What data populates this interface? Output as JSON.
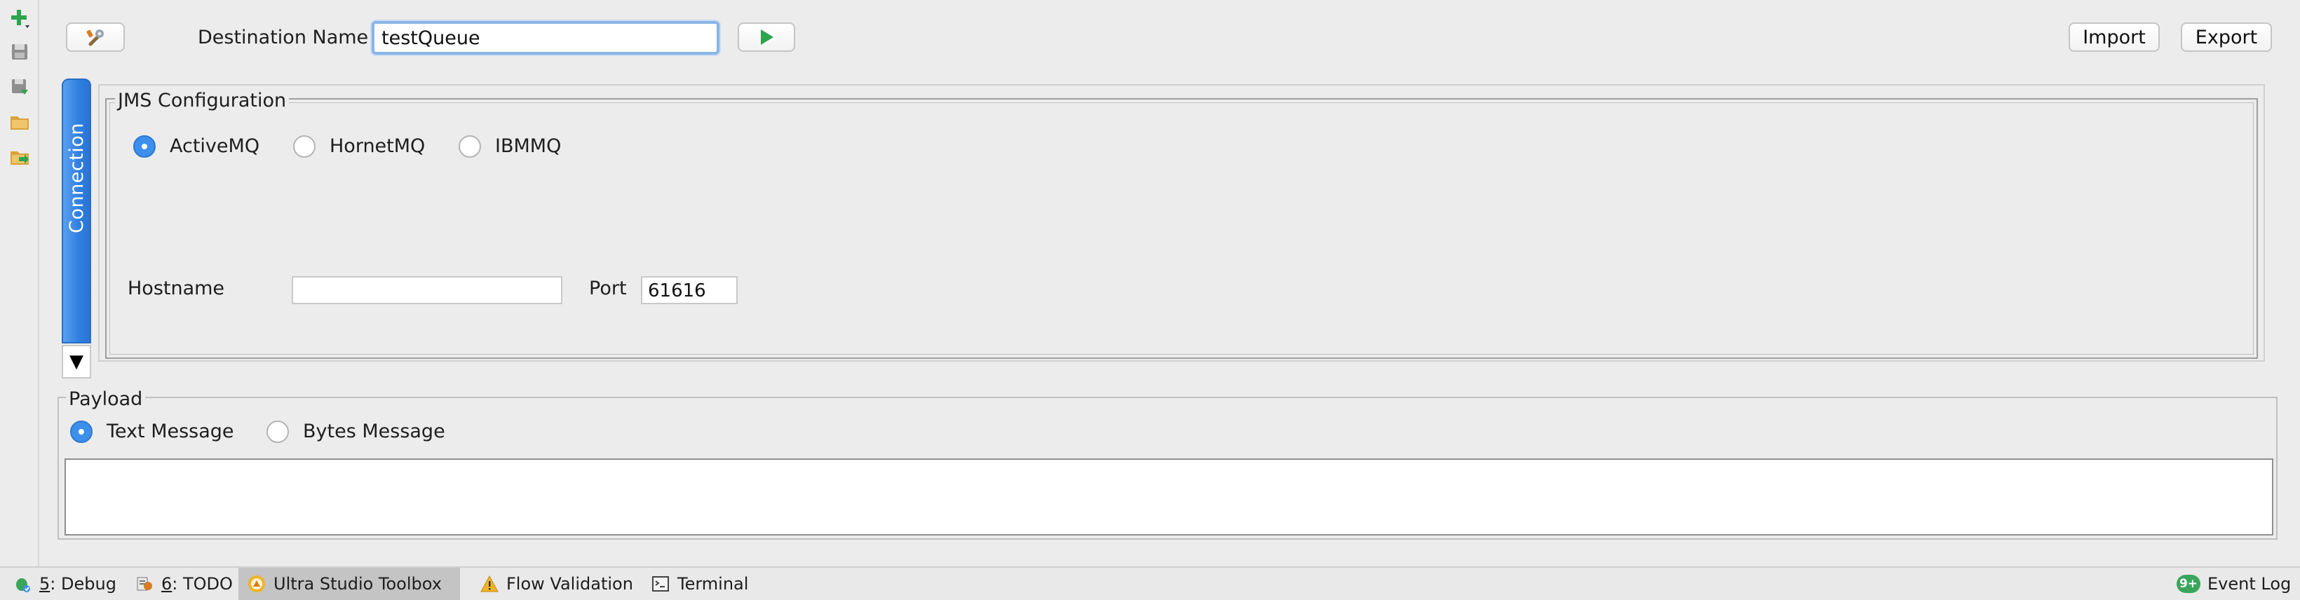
{
  "toolbar": {
    "destination_label": "Destination Name",
    "destination_value": "testQueue",
    "import_label": "Import",
    "export_label": "Export"
  },
  "left_toolbar": {
    "icons": [
      "add-icon",
      "save-icon",
      "save-as-icon",
      "open-folder-icon",
      "export-folder-icon"
    ]
  },
  "connection_tab": {
    "label": "Connection"
  },
  "jms": {
    "title": "JMS Configuration",
    "providers": [
      {
        "label": "ActiveMQ",
        "selected": true
      },
      {
        "label": "HornetMQ",
        "selected": false
      },
      {
        "label": "IBMMQ",
        "selected": false
      }
    ],
    "hostname_label": "Hostname",
    "hostname_value": "",
    "port_label": "Port",
    "port_value": "61616"
  },
  "payload": {
    "title": "Payload",
    "types": [
      {
        "label": "Text Message",
        "selected": true
      },
      {
        "label": "Bytes Message",
        "selected": false
      }
    ],
    "content": ""
  },
  "status_bar": {
    "debug_key": "5",
    "debug_label": ": Debug",
    "todo_key": "6",
    "todo_label": ": TODO",
    "ultra_label": "Ultra Studio Toolbox",
    "flow_label": "Flow Validation",
    "terminal_label": "Terminal",
    "event_badge": "9+",
    "event_label": "Event Log"
  },
  "colors": {
    "accent": "#3d8fec",
    "run_green": "#2da44e",
    "tab_blue": "#2f7fe0"
  }
}
